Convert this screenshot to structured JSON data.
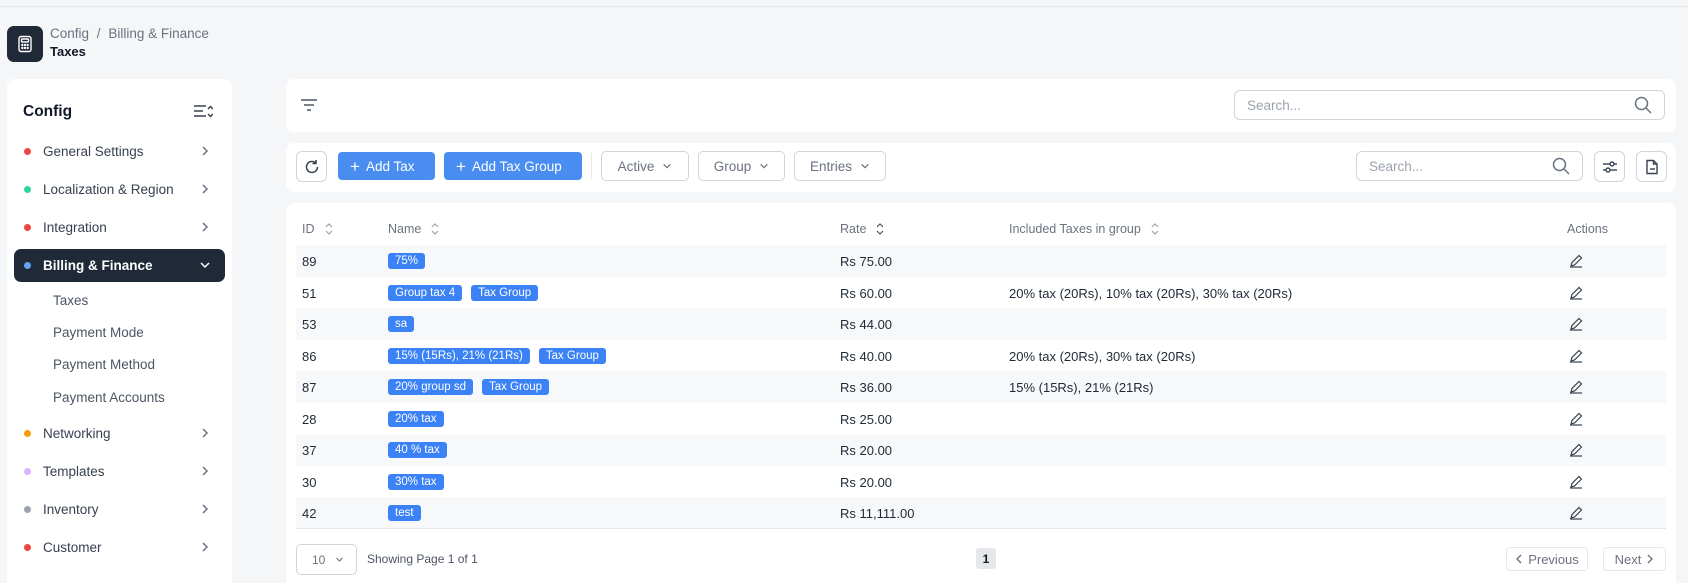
{
  "breadcrumb": {
    "root": "Config",
    "separator": "/",
    "section": "Billing & Finance"
  },
  "page_title": "Taxes",
  "sidebar": {
    "title": "Config",
    "items": [
      {
        "label": "General Settings",
        "color": "#ef4444"
      },
      {
        "label": "Localization & Region",
        "color": "#34d399"
      },
      {
        "label": "Integration",
        "color": "#ef4444"
      },
      {
        "label": "Billing & Finance",
        "color": "#60a5fa"
      },
      {
        "label": "Networking",
        "color": "#f59e0b"
      },
      {
        "label": "Templates",
        "color": "#d8b4fe"
      },
      {
        "label": "Inventory",
        "color": "#9ca3af"
      },
      {
        "label": "Customer",
        "color": "#ef4444"
      }
    ],
    "sub_items": [
      "Taxes",
      "Payment Mode",
      "Payment Method",
      "Payment Accounts"
    ]
  },
  "top_search": {
    "placeholder": "Search..."
  },
  "toolbar": {
    "add_tax": "Add Tax",
    "add_tax_group": "Add Tax Group",
    "filter_active": "Active",
    "filter_group": "Group",
    "filter_entries": "Entries",
    "search_placeholder": "Search..."
  },
  "table": {
    "headers": {
      "id": "ID",
      "name": "Name",
      "rate": "Rate",
      "included": "Included Taxes in group",
      "actions": "Actions"
    },
    "group_badge": "Tax Group",
    "rows": [
      {
        "id": "89",
        "name": "75%",
        "group": false,
        "rate": "Rs 75.00",
        "included": ""
      },
      {
        "id": "51",
        "name": "Group tax 4",
        "group": true,
        "rate": "Rs 60.00",
        "included": "20% tax (20Rs), 10% tax (20Rs), 30% tax (20Rs)"
      },
      {
        "id": "53",
        "name": "sa",
        "group": false,
        "rate": "Rs 44.00",
        "included": ""
      },
      {
        "id": "86",
        "name": "15% (15Rs), 21% (21Rs)",
        "group": true,
        "rate": "Rs 40.00",
        "included": "20% tax (20Rs), 30% tax (20Rs)"
      },
      {
        "id": "87",
        "name": "20% group sd",
        "group": true,
        "rate": "Rs 36.00",
        "included": "15% (15Rs), 21% (21Rs)"
      },
      {
        "id": "28",
        "name": "20% tax",
        "group": false,
        "rate": "Rs 25.00",
        "included": ""
      },
      {
        "id": "37",
        "name": "40 % tax",
        "group": false,
        "rate": "Rs 20.00",
        "included": ""
      },
      {
        "id": "30",
        "name": "30% tax",
        "group": false,
        "rate": "Rs 20.00",
        "included": ""
      },
      {
        "id": "42",
        "name": "test",
        "group": false,
        "rate": "Rs 11,111.00",
        "included": ""
      }
    ]
  },
  "pagination": {
    "page_size": "10",
    "info": "Showing Page 1 of 1",
    "current": "1",
    "prev": "Previous",
    "next": "Next"
  },
  "colors": {
    "accent": "#4a8df0",
    "sidebar_active": "#1f2937"
  }
}
